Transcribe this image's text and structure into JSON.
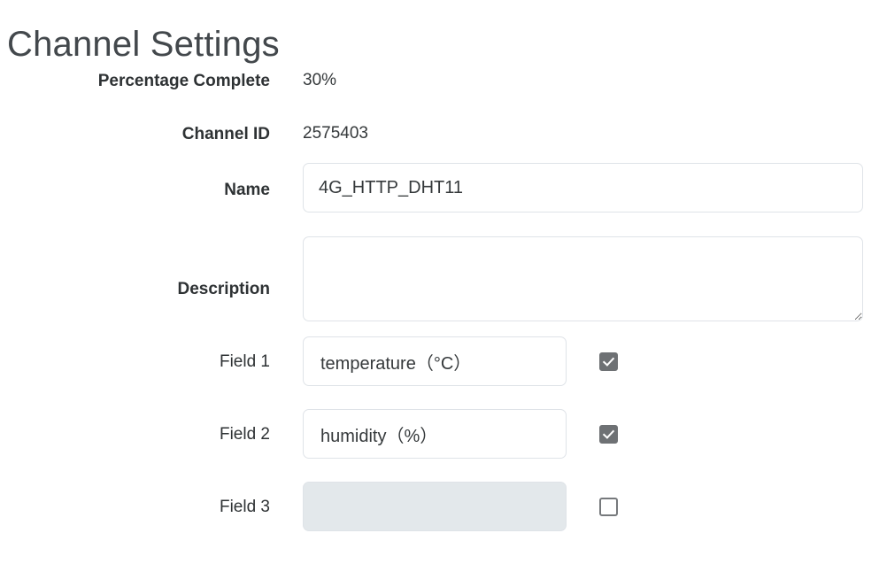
{
  "page": {
    "title": "Channel Settings"
  },
  "form": {
    "percentage": {
      "label": "Percentage Complete",
      "value": "30%"
    },
    "channel_id": {
      "label": "Channel ID",
      "value": "2575403"
    },
    "name": {
      "label": "Name",
      "value": "4G_HTTP_DHT11",
      "placeholder": ""
    },
    "description": {
      "label": "Description",
      "value": "",
      "placeholder": ""
    },
    "fields": [
      {
        "label": "Field 1",
        "value": "temperature（°C）",
        "placeholder": "",
        "checked": true,
        "disabled": false
      },
      {
        "label": "Field 2",
        "value": "humidity（%）",
        "placeholder": "",
        "checked": true,
        "disabled": false
      },
      {
        "label": "Field 3",
        "value": "",
        "placeholder": "",
        "checked": false,
        "disabled": true
      }
    ]
  },
  "colors": {
    "page_background": "#ffffff",
    "title_text": "#43484c",
    "label_text": "#2e3234",
    "input_border": "#dfe3e8",
    "disabled_input_background": "#e3e8eb",
    "checkbox_checked": "#6e7174",
    "checkbox_border": "#76797c"
  }
}
